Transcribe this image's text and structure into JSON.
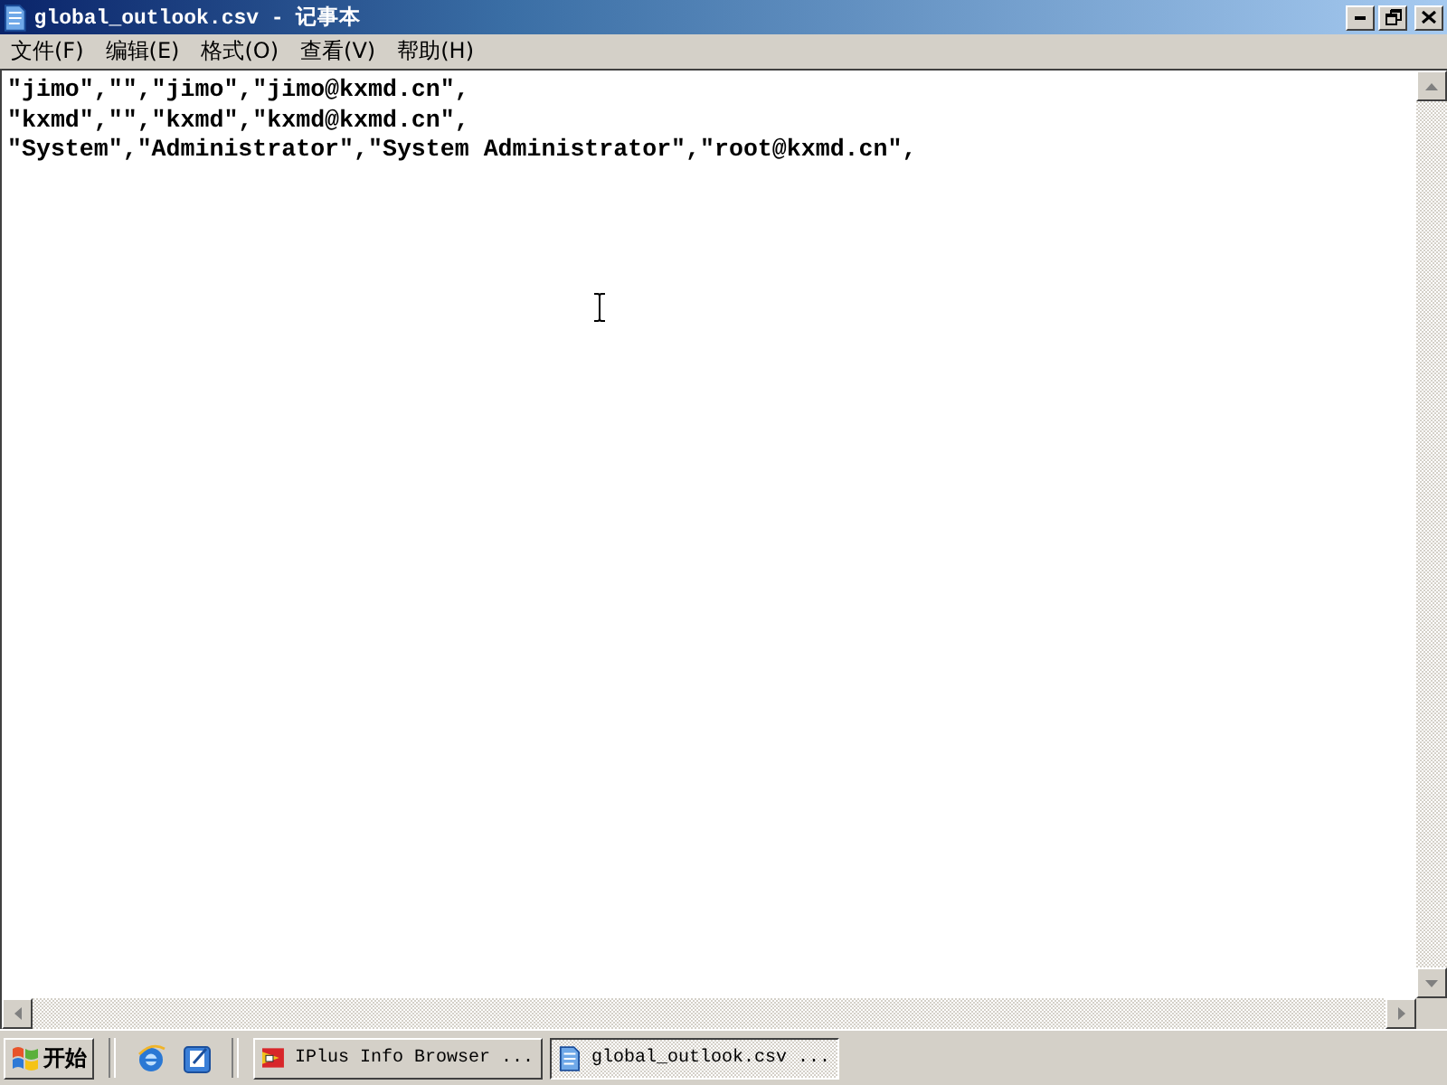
{
  "window": {
    "title": "global_outlook.csv - 记事本"
  },
  "menu": [
    {
      "label": "文件(F)"
    },
    {
      "label": "编辑(E)"
    },
    {
      "label": "格式(O)"
    },
    {
      "label": "查看(V)"
    },
    {
      "label": "帮助(H)"
    }
  ],
  "document": {
    "lines": [
      "\"jimo\",\"\",\"jimo\",\"jimo@kxmd.cn\",",
      "\"kxmd\",\"\",\"kxmd\",\"kxmd@kxmd.cn\",",
      "\"System\",\"Administrator\",\"System Administrator\",\"root@kxmd.cn\","
    ]
  },
  "taskbar": {
    "start_label": "开始",
    "tasks": [
      {
        "kind": "browser",
        "label": "IPlus Info Browser ...",
        "selected": false
      },
      {
        "kind": "notepad",
        "label": "global_outlook.csv ...",
        "selected": true
      }
    ]
  }
}
